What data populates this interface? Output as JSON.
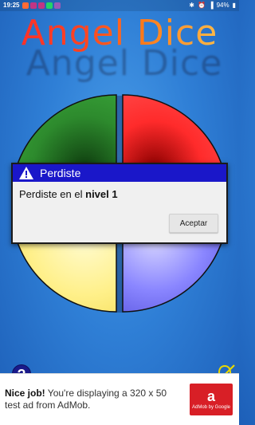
{
  "status_bar": {
    "time": "19:25",
    "battery": "94%"
  },
  "app": {
    "title": "Angel Dice"
  },
  "dialog": {
    "title": "Perdiste",
    "message_prefix": "Perdiste en el",
    "message_level": "nivel 1",
    "ok_label": "Aceptar"
  },
  "buttons": {
    "help_symbol": "?"
  },
  "ad": {
    "headline": "Nice job!",
    "body": "You're displaying a 320 x 50 test ad from AdMob.",
    "logo_caption": "AdMob by Google",
    "logo_symbol": "a"
  },
  "colors": {
    "dialog_header": "#1a17c9",
    "quadrant_green": "#2d8a2d",
    "quadrant_red": "#ff2b2b",
    "quadrant_yellow": "#fff08a",
    "quadrant_blue": "#8a86ff"
  }
}
